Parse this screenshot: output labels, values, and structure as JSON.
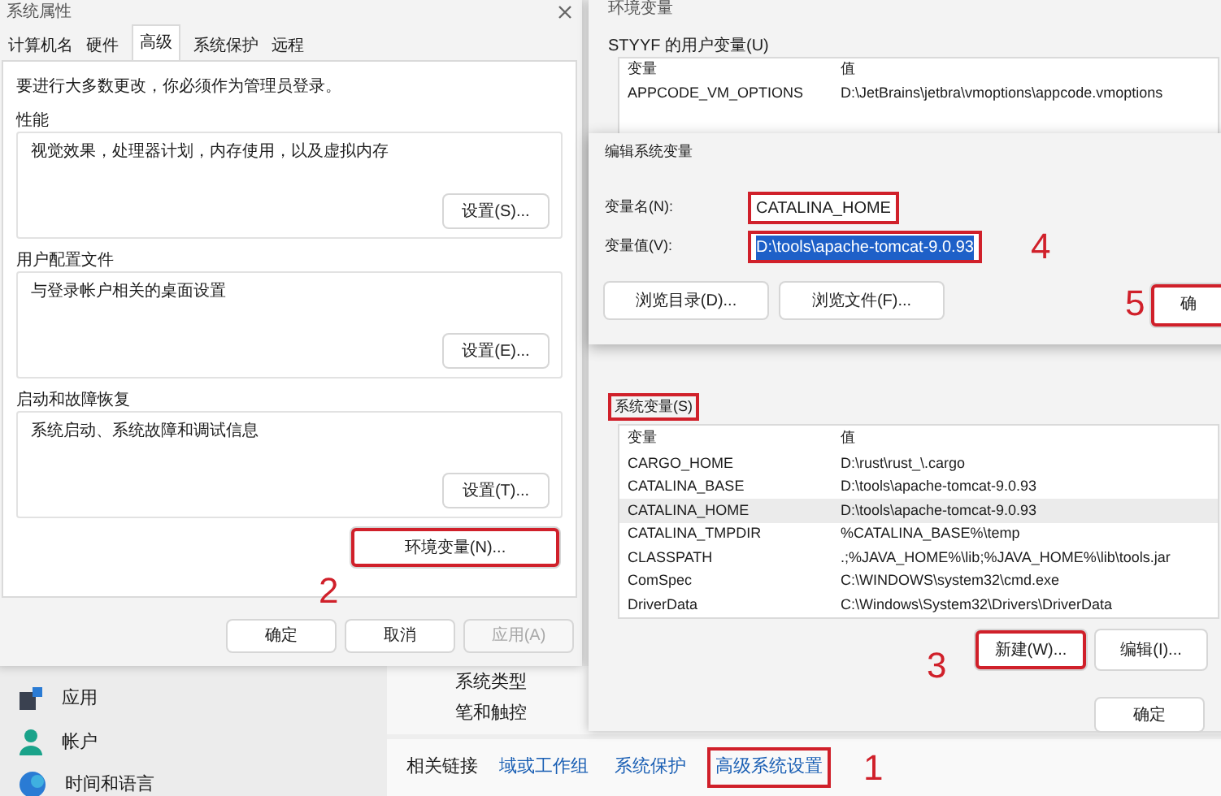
{
  "settings": {
    "nav": [
      {
        "label": "应用",
        "kind": "apps"
      },
      {
        "label": "帐户",
        "kind": "account"
      },
      {
        "label": "时间和语言",
        "kind": "globe"
      }
    ],
    "items": [
      "系统类型",
      "笔和触控"
    ],
    "related": {
      "label": "相关链接",
      "links": [
        {
          "label": "域或工作组",
          "highlighted": false
        },
        {
          "label": "系统保护",
          "highlighted": false
        },
        {
          "label": "高级系统设置",
          "highlighted": true,
          "step": "1"
        }
      ]
    }
  },
  "system_properties": {
    "title": "系统属性",
    "tabs": [
      {
        "label": "计算机名",
        "selected": false
      },
      {
        "label": "硬件",
        "selected": false
      },
      {
        "label": "高级",
        "selected": true
      },
      {
        "label": "系统保护",
        "selected": false
      },
      {
        "label": "远程",
        "selected": false
      }
    ],
    "notice": "要进行大多数更改，你必须作为管理员登录。",
    "groups": [
      {
        "title": "性能",
        "description": "视觉效果，处理器计划，内存使用，以及虚拟内存",
        "button": "设置(S)..."
      },
      {
        "title": "用户配置文件",
        "description": "与登录帐户相关的桌面设置",
        "button": "设置(E)..."
      },
      {
        "title": "启动和故障恢复",
        "description": "系统启动、系统故障和调试信息",
        "button": "设置(T)..."
      }
    ],
    "env_button": {
      "label": "环境变量(N)...",
      "highlighted": true,
      "step": "2"
    },
    "buttons": [
      {
        "label": "确定",
        "disabled": false
      },
      {
        "label": "取消",
        "disabled": false
      },
      {
        "label": "应用(A)",
        "disabled": true
      }
    ]
  },
  "env_vars": {
    "title": "环境变量",
    "user_section": {
      "title": "STYYF 的用户变量(U)",
      "columns": [
        "变量",
        "值"
      ],
      "rows": [
        {
          "name": "APPCODE_VM_OPTIONS",
          "value": "D:\\JetBrains\\jetbra\\vmoptions\\appcode.vmoptions",
          "selected": false
        }
      ]
    },
    "system_section": {
      "title": "系统变量(S)",
      "highlighted": true,
      "columns": [
        "变量",
        "值"
      ],
      "rows": [
        {
          "name": "CARGO_HOME",
          "value": "D:\\rust\\rust_\\.cargo",
          "selected": false
        },
        {
          "name": "CATALINA_BASE",
          "value": "D:\\tools\\apache-tomcat-9.0.93",
          "selected": false
        },
        {
          "name": "CATALINA_HOME",
          "value": "D:\\tools\\apache-tomcat-9.0.93",
          "selected": true
        },
        {
          "name": "CATALINA_TMPDIR",
          "value": "%CATALINA_BASE%\\temp",
          "selected": false
        },
        {
          "name": "CLASSPATH",
          "value": ".;%JAVA_HOME%\\lib;%JAVA_HOME%\\lib\\tools.jar",
          "selected": false
        },
        {
          "name": "ComSpec",
          "value": "C:\\WINDOWS\\system32\\cmd.exe",
          "selected": false
        },
        {
          "name": "DriverData",
          "value": "C:\\Windows\\System32\\Drivers\\DriverData",
          "selected": false
        }
      ],
      "buttons": [
        {
          "label": "新建(W)...",
          "highlighted": true,
          "step": "3"
        },
        {
          "label": "编辑(I)...",
          "highlighted": false
        }
      ]
    },
    "buttons": [
      {
        "label": "确定"
      }
    ]
  },
  "edit_dialog": {
    "title": "编辑系统变量",
    "fields": [
      {
        "label": "变量名(N):",
        "value": "CATALINA_HOME",
        "selected": false,
        "highlighted": true
      },
      {
        "label": "变量值(V):",
        "value": "D:\\tools\\apache-tomcat-9.0.93",
        "selected": true,
        "highlighted": true,
        "step": "4"
      }
    ],
    "buttons": [
      {
        "label": "浏览目录(D)..."
      },
      {
        "label": "浏览文件(F)..."
      }
    ],
    "ok": {
      "label": "确",
      "highlighted": true,
      "step": "5"
    }
  }
}
